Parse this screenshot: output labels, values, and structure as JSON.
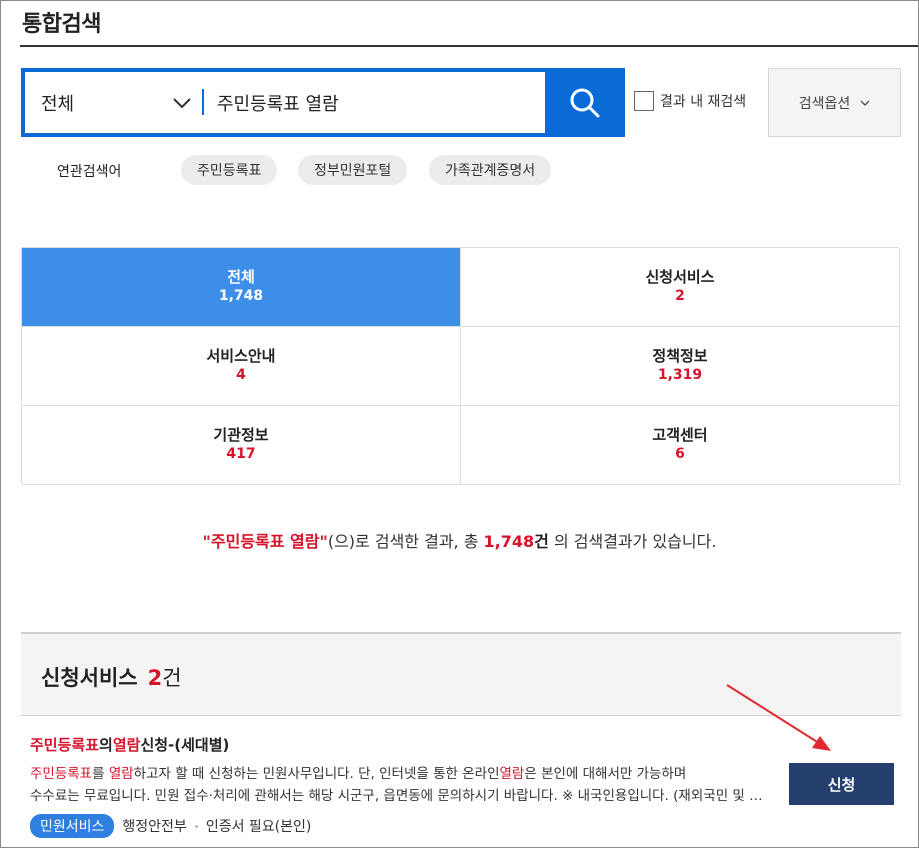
{
  "page_title": "통합검색",
  "search": {
    "scope_label": "전체",
    "query": "주민등록표 열람",
    "research_label": "결과 내 재검색",
    "options_label": "검색옵션"
  },
  "related": {
    "label": "연관검색어",
    "keywords": [
      "주민등록표",
      "정부민원포털",
      "가족관계증명서"
    ]
  },
  "categories": [
    {
      "name": "전체",
      "count": "1,748"
    },
    {
      "name": "신청서비스",
      "count": "2"
    },
    {
      "name": "서비스안내",
      "count": "4"
    },
    {
      "name": "정책정보",
      "count": "1,319"
    },
    {
      "name": "기관정보",
      "count": "417"
    },
    {
      "name": "고객센터",
      "count": "6"
    }
  ],
  "summary": {
    "keyword": "\"주민등록표 열람\"",
    "mid": "(으)로 검색한 결과, 총",
    "total": "1,748",
    "unit": "건",
    "tail": "의 검색결과가 있습니다."
  },
  "section": {
    "title": "신청서비스",
    "count": "2",
    "unit": "건"
  },
  "result": {
    "title_parts": [
      "주민등록표",
      "의",
      "열람",
      "신청-(세대별)"
    ],
    "desc_line1_parts": [
      "주민등록표",
      "를 ",
      "열람",
      "하고자 할 때 신청하는 민원사무입니다. 단, 인터넷을 통한 온라인",
      "열람",
      "은 본인에 대해서만 가능하며"
    ],
    "desc_line2": "수수료는 무료입니다. 민원 접수·처리에 관해서는 해당 시군구, 읍면동에 문의하시기 바랍니다. ※ 내국인용입니다. (재외국민 및 외국인 제외)",
    "tag": "민원서비스",
    "agency": "행정안전부",
    "auth": "인증서 필요(본인)",
    "apply_label": "신청"
  },
  "colors": {
    "primary": "#0b6bd6",
    "active_tab": "#3d8ee8",
    "highlight": "#d7132b",
    "apply_button": "#243f6e",
    "annotation_arrow": "#e0282e"
  }
}
